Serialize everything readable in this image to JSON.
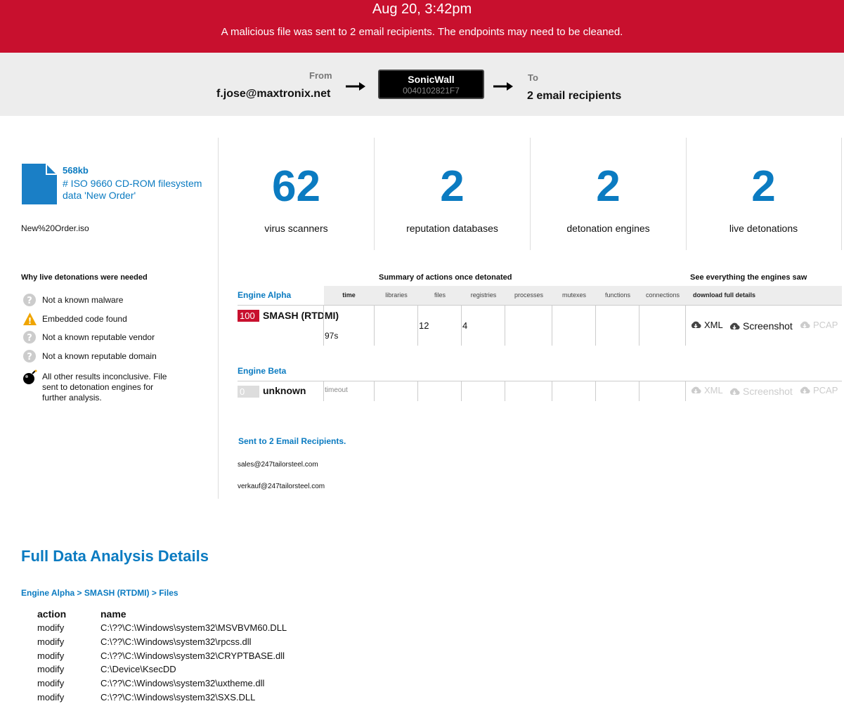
{
  "banner": {
    "date": "Aug 20, 3:42pm",
    "message": "A malicious file was sent to 2 email recipients. The endpoints may need to be cleaned.",
    "color": "#c8102e"
  },
  "route": {
    "from_label": "From",
    "from_value": "f.jose@maxtronix.net",
    "device_name": "SonicWall",
    "device_serial": "0040102821F7",
    "to_label": "To",
    "to_value": "2 email recipients"
  },
  "file": {
    "icon": "file-icon",
    "size": "568kb",
    "type": "# ISO 9660 CD-ROM filesystem data 'New Order'",
    "name": "New%20Order.iso"
  },
  "why": {
    "title": "Why live detonations were needed",
    "items": [
      {
        "icon": "question-icon",
        "text": "Not a known malware"
      },
      {
        "icon": "warning-icon",
        "text": "Embedded code found"
      },
      {
        "icon": "question-icon",
        "text": "Not a known reputable vendor"
      },
      {
        "icon": "question-icon",
        "text": "Not a known reputable domain"
      },
      {
        "icon": "bomb-icon",
        "text": "All other results inconclusive. File sent to detonation engines for further analysis."
      }
    ]
  },
  "stats": [
    {
      "value": "62",
      "label": "virus scanners"
    },
    {
      "value": "2",
      "label": "reputation databases"
    },
    {
      "value": "2",
      "label": "detonation engines"
    },
    {
      "value": "2",
      "label": "live detonations"
    }
  ],
  "summary": {
    "title": "Summary of actions once detonated",
    "see_title": "See everything the engines saw",
    "columns": [
      "time",
      "libraries",
      "files",
      "registries",
      "processes",
      "mutexes",
      "functions",
      "connections"
    ],
    "download_header": "download full details",
    "engines": [
      {
        "name": "Engine Alpha",
        "score": "100",
        "score_color": "#c8102e",
        "verdict": "SMASH (RTDMI)",
        "time": "97s",
        "files": "12",
        "registries": "4",
        "downloads": [
          "XML",
          "Screenshot",
          "PCAP"
        ]
      },
      {
        "name": "Engine Beta",
        "score": "0",
        "score_color": "#dddddd",
        "verdict": "unknown",
        "time": "timeout",
        "downloads": [
          "XML",
          "Screenshot",
          "PCAP"
        ]
      }
    ]
  },
  "recipients": {
    "title": "Sent to 2 Email Recipients.",
    "list": [
      "sales@247tailorsteel.com",
      "verkauf@247tailorsteel.com"
    ]
  },
  "full": {
    "title": "Full Data Analysis Details",
    "breadcrumb": "Engine Alpha > SMASH (RTDMI) > Files",
    "headers": [
      "action",
      "name"
    ],
    "rows": [
      [
        "modify",
        "C:\\??\\C:\\Windows\\system32\\MSVBVM60.DLL"
      ],
      [
        "modify",
        "C:\\??\\C:\\Windows\\system32\\rpcss.dll"
      ],
      [
        "modify",
        "C:\\??\\C:\\Windows\\system32\\CRYPTBASE.dll"
      ],
      [
        "modify",
        "C:\\Device\\KsecDD"
      ],
      [
        "modify",
        "C:\\??\\C:\\Windows\\system32\\uxtheme.dll"
      ],
      [
        "modify",
        "C:\\??\\C:\\Windows\\system32\\SXS.DLL"
      ]
    ]
  }
}
